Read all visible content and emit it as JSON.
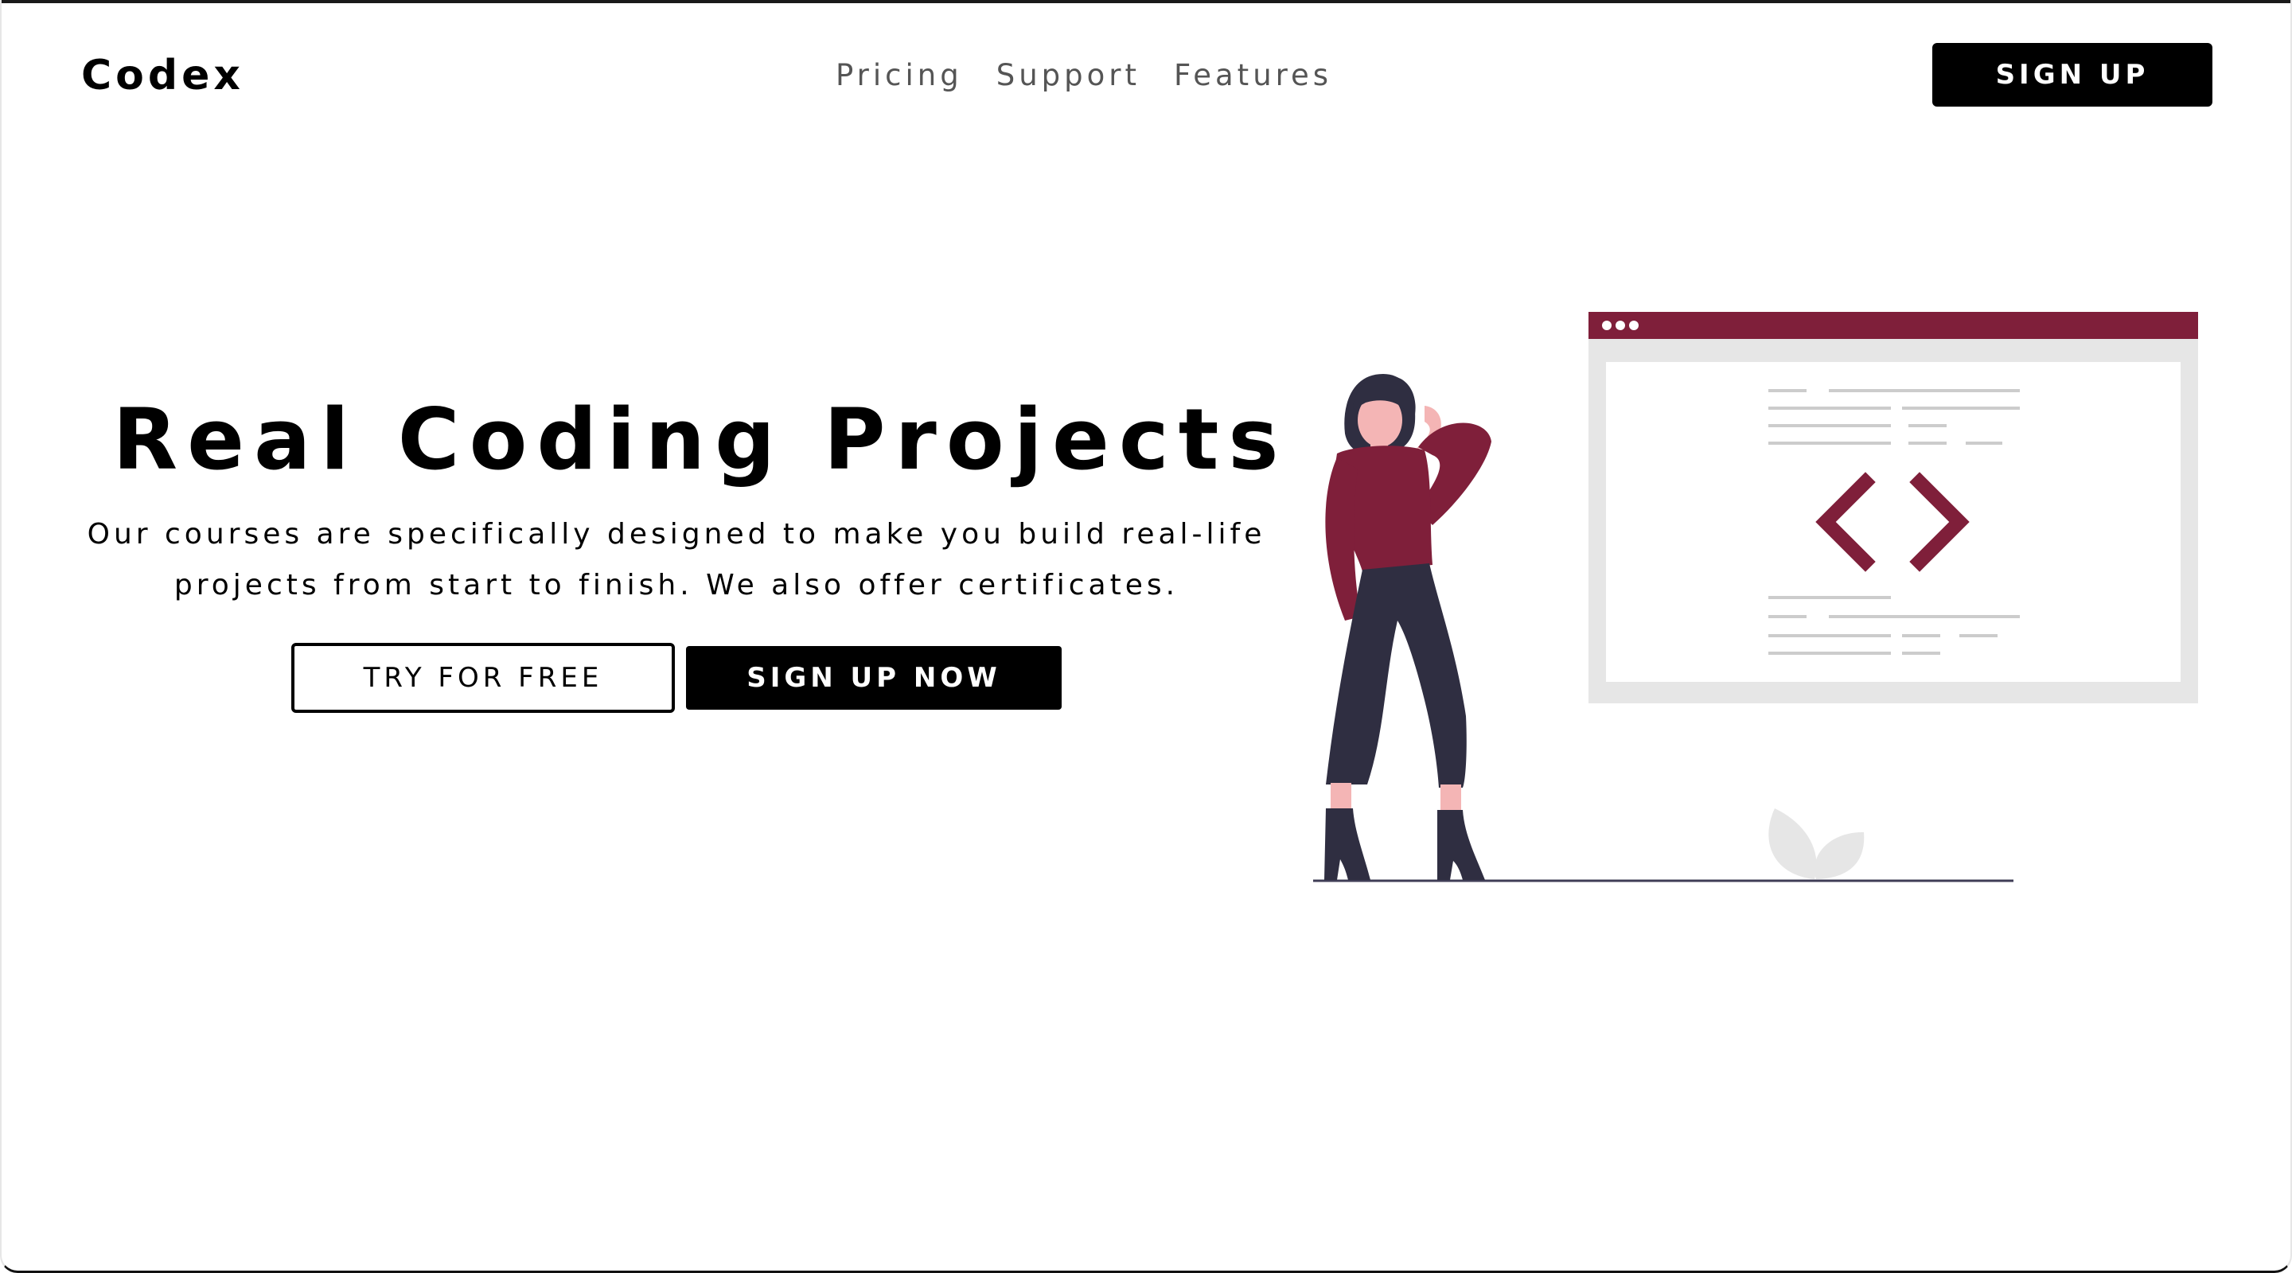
{
  "header": {
    "logo": "Codex",
    "nav": [
      {
        "label": "Pricing"
      },
      {
        "label": "Support"
      },
      {
        "label": "Features"
      }
    ],
    "signup_label": "SIGN UP"
  },
  "hero": {
    "title": "Real Coding Projects",
    "description_lines": [
      "Our courses are specifically designed to make you build real-life",
      "projects from start to finish. We also offer certificates."
    ],
    "try_free_label": "TRY FOR FREE",
    "signup_now_label": "SIGN UP NOW"
  },
  "illustration": {
    "icon": "code-brackets-icon"
  },
  "colors": {
    "accent": "#7f1f3a",
    "dark": "#2f2e41",
    "panel_gray": "#e6e6e6",
    "text_line_gray": "#cccccc"
  }
}
